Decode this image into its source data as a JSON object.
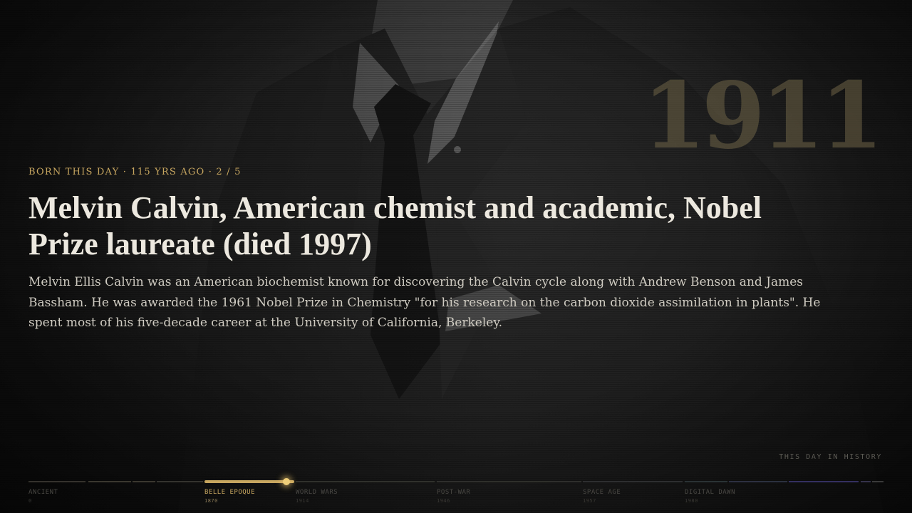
{
  "slide": {
    "year": "1911",
    "eyebrow": "BORN THIS DAY · 115 YRS AGO · 2 / 5",
    "title": "Melvin Calvin, American chemist and academic, Nobel Prize laureate (died 1997)",
    "description": "Melvin Ellis Calvin was an American biochemist known for discovering the Calvin cycle along with Andrew Benson and James Bassham. He was awarded the 1961 Nobel Prize in Chemistry \"for his research on the carbon dioxide assimilation in plants\". He spent most of his five-decade career at the University of California, Berkeley."
  },
  "brand": "THIS DAY IN HISTORY",
  "timeline": {
    "accent_color": "#c7a660",
    "eras": [
      {
        "label": "ANCIENT",
        "year": "0"
      },
      {
        "label": "BELLE EPOQUE",
        "year": "1870",
        "active": true
      },
      {
        "label": "WORLD WARS",
        "year": "1914"
      },
      {
        "label": "POST-WAR",
        "year": "1946"
      },
      {
        "label": "SPACE AGE",
        "year": "1957"
      },
      {
        "label": "DIGITAL DAWN",
        "year": "1980"
      }
    ]
  }
}
